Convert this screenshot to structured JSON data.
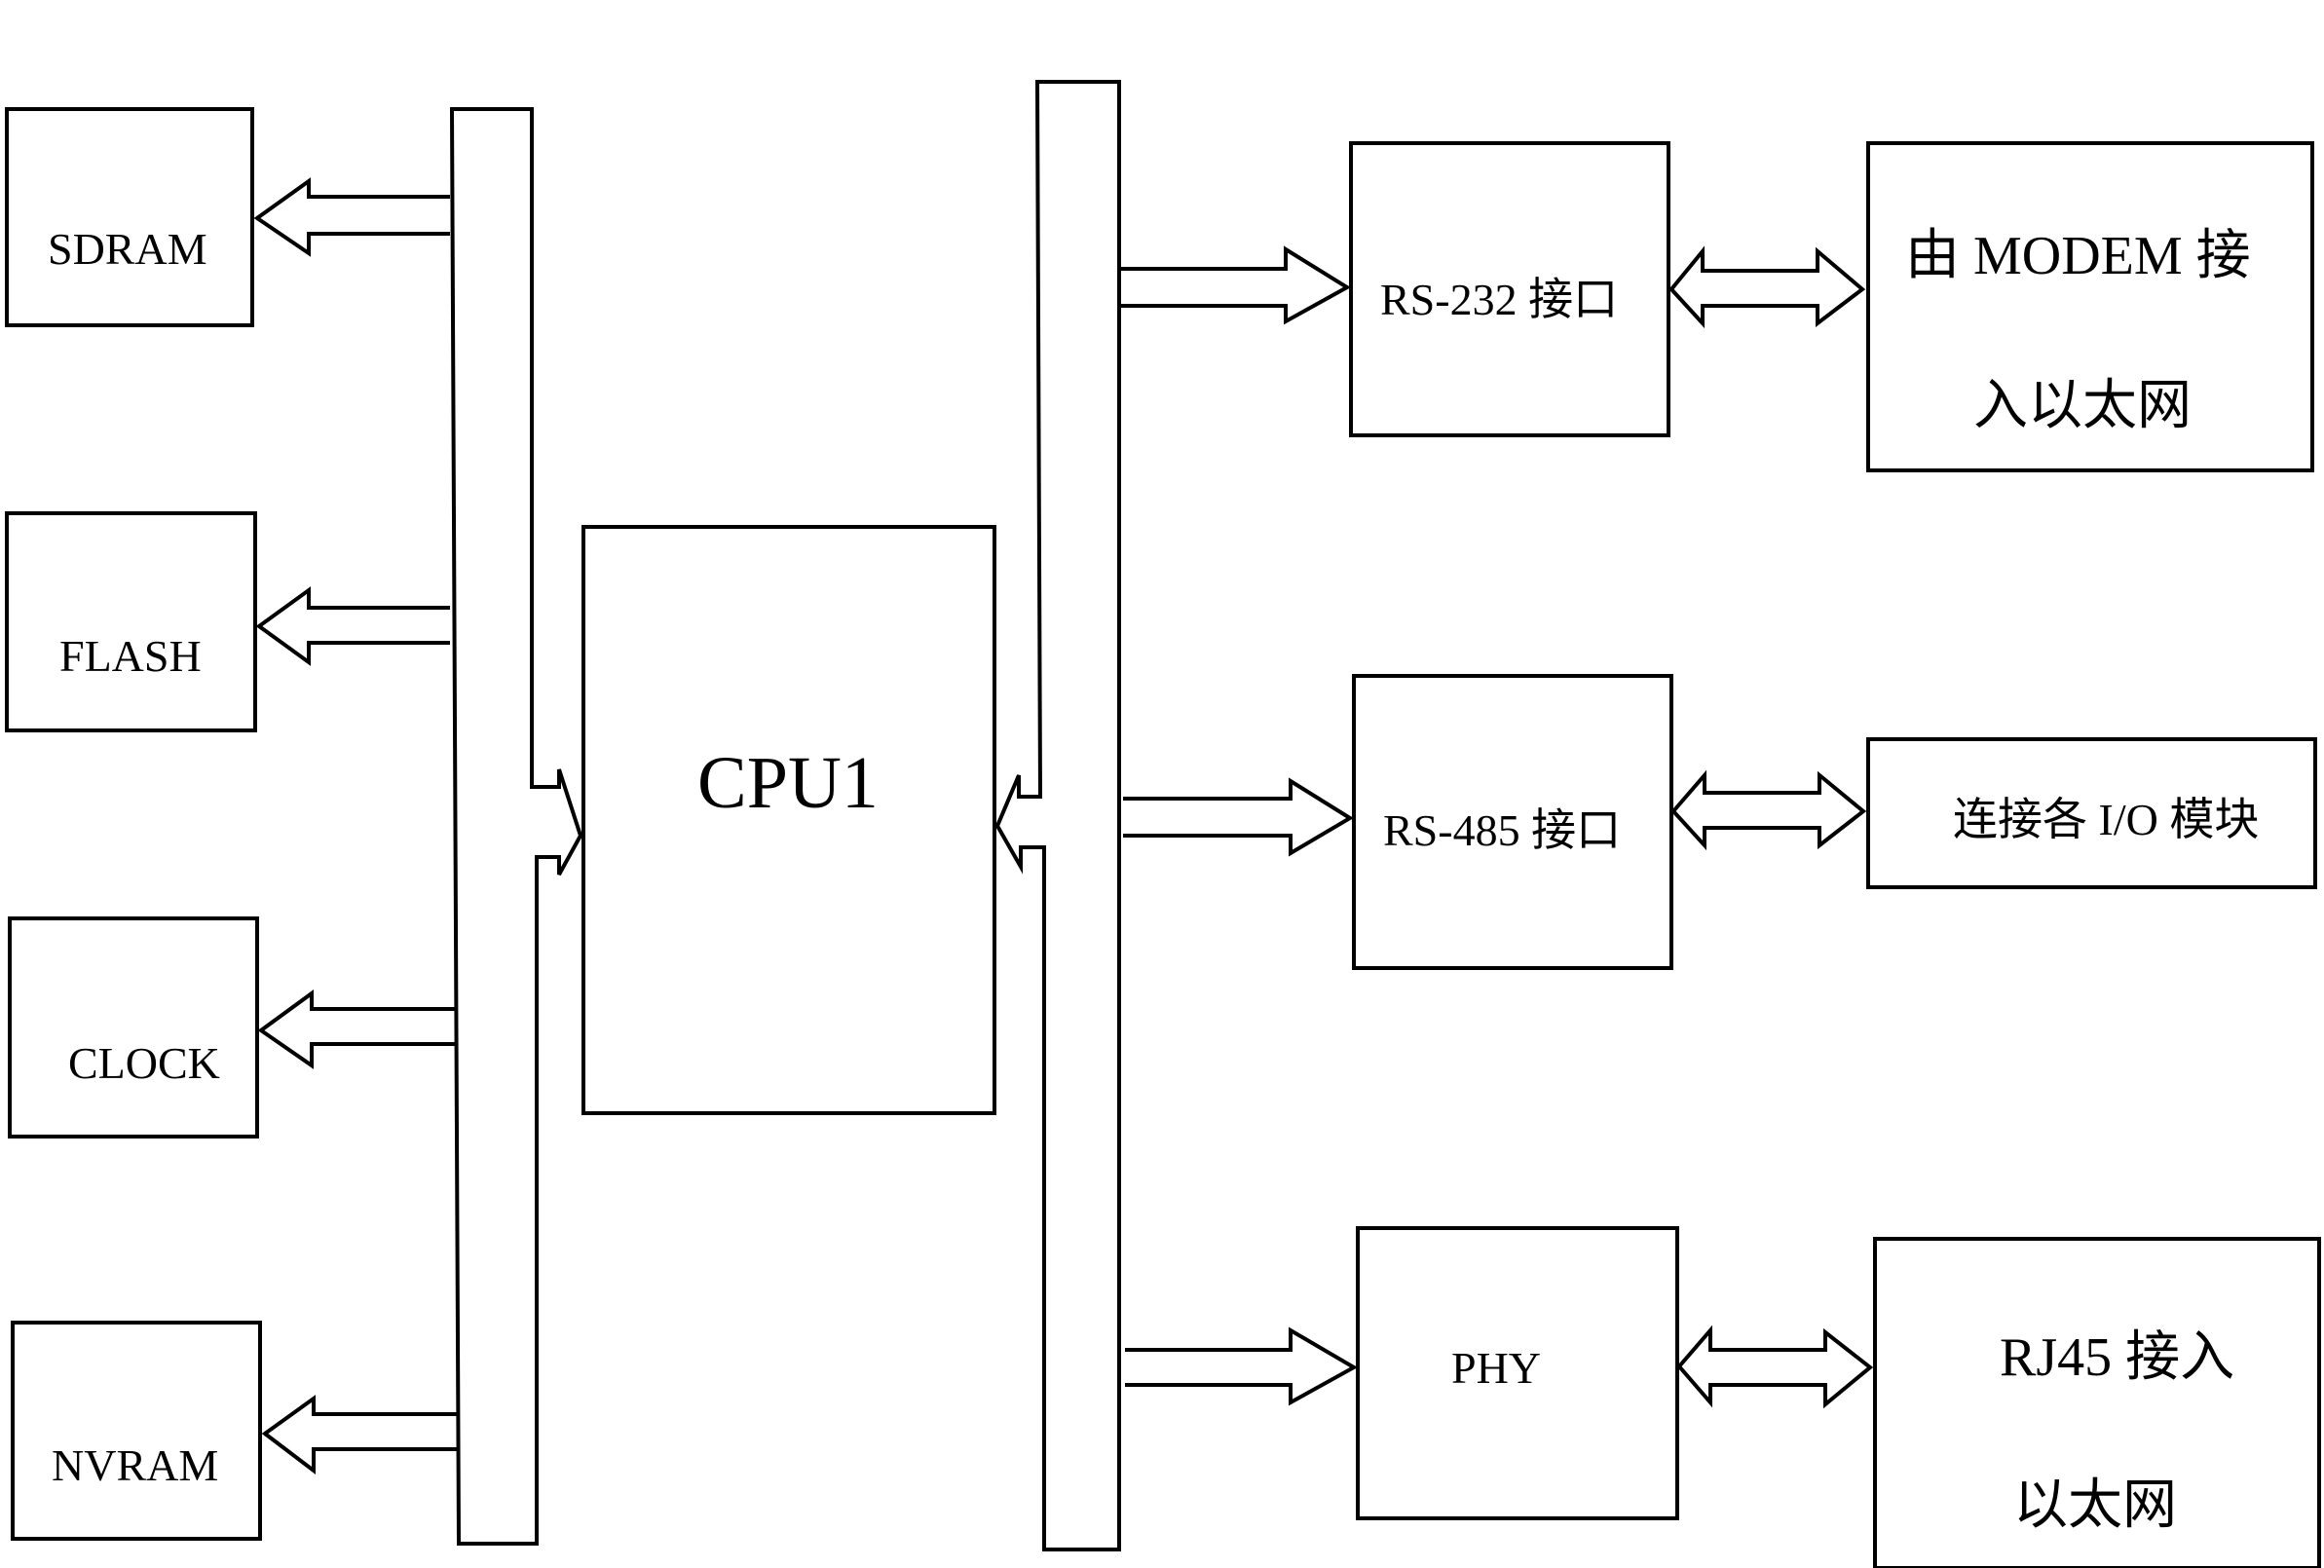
{
  "diagram": {
    "title": "",
    "left_blocks": [
      {
        "id": "sdram",
        "label": "SDRAM"
      },
      {
        "id": "flash",
        "label": "FLASH"
      },
      {
        "id": "clock",
        "label": "CLOCK"
      },
      {
        "id": "nvram",
        "label": "NVRAM"
      }
    ],
    "cpu": {
      "label": "CPU1"
    },
    "right_interfaces": [
      {
        "id": "rs232",
        "label": "RS-232 接口"
      },
      {
        "id": "rs485",
        "label": "RS-485 接口"
      },
      {
        "id": "phy",
        "label": "PHY"
      }
    ],
    "endpoints": [
      {
        "id": "modem",
        "line1": "由 MODEM 接",
        "line2": "入以太网"
      },
      {
        "id": "io",
        "line1": "连接各 I/O 模块"
      },
      {
        "id": "rj45",
        "line1": "RJ45 接入",
        "line2": "以太网"
      }
    ],
    "connections": [
      {
        "from": "left-bus",
        "to": "sdram",
        "type": "arrow"
      },
      {
        "from": "left-bus",
        "to": "flash",
        "type": "arrow"
      },
      {
        "from": "left-bus",
        "to": "clock",
        "type": "arrow"
      },
      {
        "from": "left-bus",
        "to": "nvram",
        "type": "arrow"
      },
      {
        "from": "left-bus",
        "to": "cpu",
        "type": "arrow"
      },
      {
        "from": "right-bus",
        "to": "cpu",
        "type": "arrow"
      },
      {
        "from": "right-bus",
        "to": "rs232",
        "type": "arrow"
      },
      {
        "from": "right-bus",
        "to": "rs485",
        "type": "arrow"
      },
      {
        "from": "right-bus",
        "to": "phy",
        "type": "arrow"
      },
      {
        "from": "rs232",
        "to": "modem",
        "type": "bidirectional"
      },
      {
        "from": "rs485",
        "to": "io",
        "type": "bidirectional"
      },
      {
        "from": "phy",
        "to": "rj45",
        "type": "bidirectional"
      }
    ]
  }
}
